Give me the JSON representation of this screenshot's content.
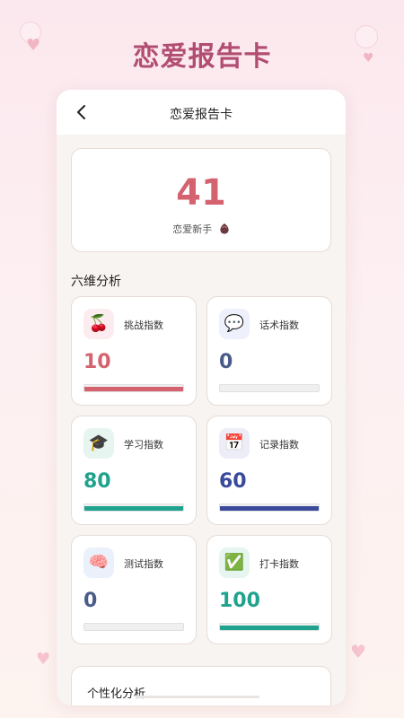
{
  "banner": {
    "title": "恋爱报告卡"
  },
  "header": {
    "title": "恋爱报告卡"
  },
  "score": {
    "value": "41",
    "level": "恋爱新手"
  },
  "section": {
    "title": "六维分析"
  },
  "metrics": [
    {
      "label": "挑战指数",
      "value": "10",
      "fill": 1.0,
      "icon": "cherry-icon",
      "glyph": "🍒",
      "color": "#d4626f",
      "bg": "#fdecef"
    },
    {
      "label": "话术指数",
      "value": "0",
      "fill": 0.0,
      "icon": "speech-bubble-icon",
      "glyph": "💬",
      "color": "#4a5a8a",
      "bg": "#eef0fb"
    },
    {
      "label": "学习指数",
      "value": "80",
      "fill": 1.0,
      "icon": "graduation-cap-icon",
      "glyph": "🎓",
      "color": "#1fa28e",
      "bg": "#e6f5ef"
    },
    {
      "label": "记录指数",
      "value": "60",
      "fill": 1.0,
      "icon": "calendar-icon",
      "glyph": "📅",
      "color": "#3a4a9a",
      "bg": "#ecedf6"
    },
    {
      "label": "测试指数",
      "value": "0",
      "fill": 0.0,
      "icon": "brain-icon",
      "glyph": "🧠",
      "color": "#4a5a8a",
      "bg": "#eaf1fb"
    },
    {
      "label": "打卡指数",
      "value": "100",
      "fill": 1.0,
      "icon": "check-box-icon",
      "glyph": "✅",
      "color": "#1fa28e",
      "bg": "#e6f5ef"
    }
  ],
  "personal": {
    "title": "个性化分析"
  }
}
